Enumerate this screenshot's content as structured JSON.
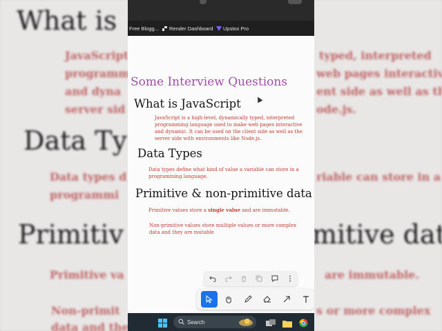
{
  "bookmarks": [
    {
      "label": "Free Blogg...",
      "icon": "blogger-icon"
    },
    {
      "label": "Render Dashboard",
      "icon": "render-icon"
    },
    {
      "label": "Upstox Pro",
      "icon": "upstox-icon"
    }
  ],
  "page": {
    "title": "Some Interview Questions",
    "sections": [
      {
        "heading": "What is JavaScript",
        "lines": [
          "JavaScript is a high-level, dynamically typed, interpreted",
          "programming language used to make web pages interactive",
          "and dynamic. It can be used on the client side as well as the",
          "server side with environments like Node.js."
        ]
      },
      {
        "heading": "Data Types",
        "lines": [
          "Data types define what kind of value a variable can store in a",
          "programming language."
        ]
      },
      {
        "heading": "Primitive & non-primitive data",
        "p1_pre": "Primitive values store a ",
        "p1_bold": "single value",
        "p1_post": " and are immutable.",
        "p2_lines": [
          "Non-primitive values store multiple values or more complex",
          "data and they are mutable"
        ]
      }
    ]
  },
  "background": {
    "h1": "What is",
    "p1a": "JavaScript",
    "p1b": "typed, interpreted",
    "p2a": "programm",
    "p2b": "web pages interactive",
    "p3a": "and dyna",
    "p3b": "ent side as well as the",
    "p4a": "server sid",
    "p4b": "ode.js.",
    "h2": "Data Ty",
    "p5a": "Data types d",
    "p5b": "riable can store in a",
    "p6a": "programmi",
    "h3a": "Primitiv",
    "h3b": "mitive data",
    "p7a": "Primitive va",
    "p7b": "are immutable.",
    "p8a": "Non-primit",
    "p8b": "s or more complex",
    "p9a": "data and the"
  },
  "toolbar_top": [
    "undo-icon",
    "redo-icon",
    "delete-icon",
    "copy-icon",
    "comment-icon",
    "more-icon"
  ],
  "toolbar_tools": [
    "select-icon",
    "hand-icon",
    "pen-icon",
    "eraser-icon",
    "arrow-icon",
    "text-icon"
  ],
  "taskbar": {
    "search_label": "Search"
  },
  "colors": {
    "title": "#a04fa8",
    "paragraph": "#c13a2e",
    "heading": "#151515",
    "accent": "#1a73e8"
  }
}
